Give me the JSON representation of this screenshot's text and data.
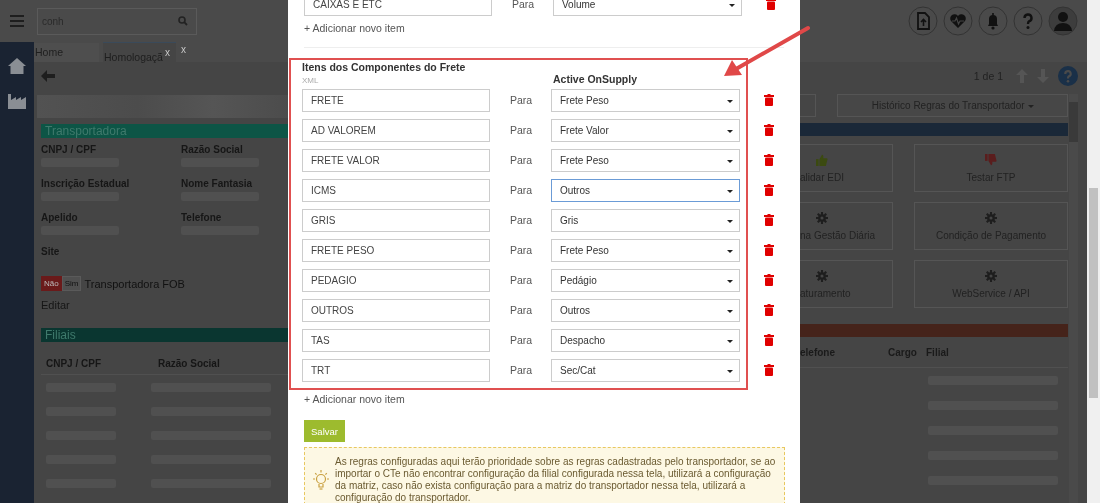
{
  "top_bar": {
    "search": {
      "value": "conh"
    }
  },
  "tabs": [
    {
      "label": "Home",
      "selected": false
    },
    {
      "label": "Homologaçã",
      "selected": true,
      "close": "x"
    }
  ],
  "extra_close": "x",
  "pager": "1 de 1",
  "transportadora": {
    "title": "Transportadora",
    "fields": [
      {
        "label": "CNPJ / CPF"
      },
      {
        "label": "Razão Social"
      },
      {
        "label": "Inscrição Estadual"
      },
      {
        "label": "Nome Fantasia"
      },
      {
        "label": "Apelido"
      },
      {
        "label": "Telefone"
      },
      {
        "label": "Site"
      }
    ]
  },
  "fob_toggle": {
    "options": [
      {
        "label": "Não",
        "selected": true
      },
      {
        "label": "Sim",
        "selected": false
      }
    ],
    "label": "Transportadora FOB"
  },
  "edit_link": "Editar",
  "filiais": {
    "title": "Filiais",
    "columns": [
      "CNPJ / CPF",
      "Razão Social"
    ]
  },
  "history_button": "Histórico Regras do Transportador",
  "tiles": [
    {
      "label": "alidar EDI",
      "kind": "like"
    },
    {
      "label": "Testar FTP",
      "kind": "dislike"
    },
    {
      "label": "na Gestão Diária",
      "kind": "gear"
    },
    {
      "label": "Condição de Pagamento",
      "kind": "gear"
    },
    {
      "label": "aturamento",
      "kind": "gear"
    },
    {
      "label": "WebService / API",
      "kind": "gear"
    }
  ],
  "contacts": {
    "columns": [
      "elefone",
      "Cargo",
      "Filial"
    ]
  },
  "modal": {
    "previous_row": {
      "xml": "CAIXAS E ETC",
      "para": "Para",
      "target": "Volume"
    },
    "add_link_top": "+ Adicionar novo item",
    "section": {
      "title": "Itens dos Componentes do Frete",
      "xml_label": "XML",
      "target_label": "Active OnSupply",
      "rows": [
        {
          "xml": "FRETE",
          "para": "Para",
          "target": "Frete Peso",
          "focused": false
        },
        {
          "xml": "AD VALOREM",
          "para": "Para",
          "target": "Frete Valor",
          "focused": false
        },
        {
          "xml": "FRETE VALOR",
          "para": "Para",
          "target": "Frete Peso",
          "focused": false
        },
        {
          "xml": "ICMS",
          "para": "Para",
          "target": "Outros",
          "focused": true
        },
        {
          "xml": "GRIS",
          "para": "Para",
          "target": "Gris",
          "focused": false
        },
        {
          "xml": "FRETE PESO",
          "para": "Para",
          "target": "Frete Peso",
          "focused": false
        },
        {
          "xml": "PEDAGIO",
          "para": "Para",
          "target": "Pedágio",
          "focused": false
        },
        {
          "xml": "OUTROS",
          "para": "Para",
          "target": "Outros",
          "focused": false
        },
        {
          "xml": "TAS",
          "para": "Para",
          "target": "Despacho",
          "focused": false
        },
        {
          "xml": "TRT",
          "para": "Para",
          "target": "Sec/Cat",
          "focused": false
        }
      ]
    },
    "add_link": "+ Adicionar novo item",
    "save_button": "Salvar",
    "notice": "As regras configuradas aqui terão prioridade sobre as regras cadastradas pelo transportador, se ao importar o CTe não encontrar configuração da filial configurada nessa tela, utilizará a configuração da matriz, caso não exista configuração para a matriz do transportador nessa tela, utilizará a configuração do transportador."
  }
}
